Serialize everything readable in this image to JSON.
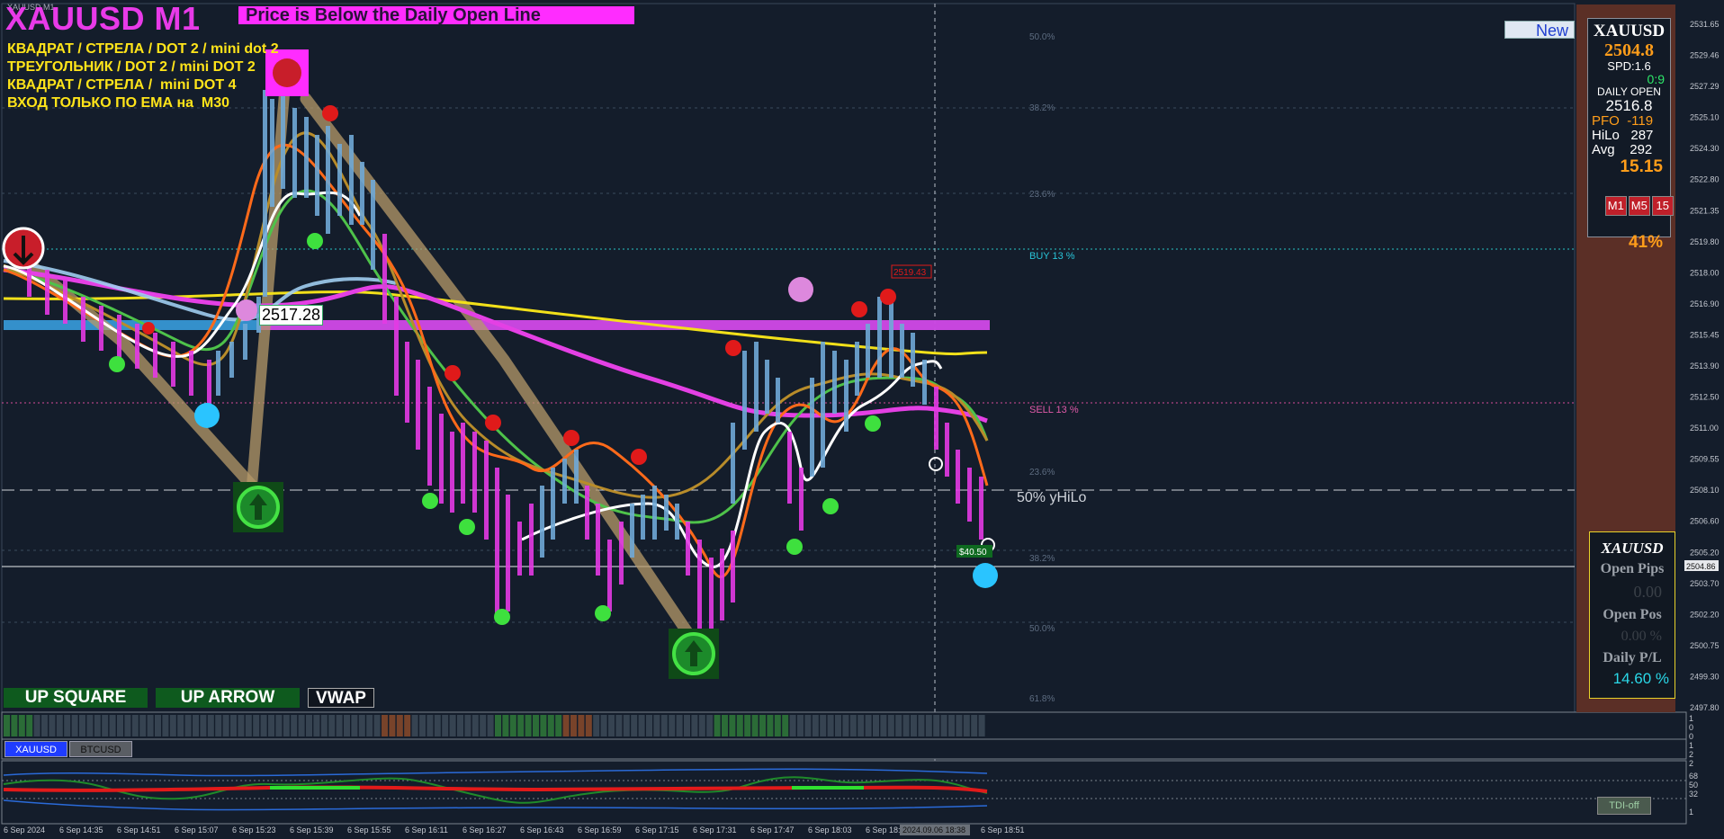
{
  "header": {
    "symbol_tiny": "XAUUSD,M1",
    "title": "XAUUSD M1",
    "banner": "Price is Below the Daily Open Line"
  },
  "notes": [
    "КВАДРАТ / СТРЕЛА / DOT 2 / mini dot 2",
    "ТРЕУГОЛЬНИК / DOT 2 / mini DOT 2",
    "КВАДРАТ / СТРЕЛА /  mini DOT 4",
    "ВХОД ТОЛЬКО ПО ЕМА на  M30"
  ],
  "new_button": "New",
  "info_panel": {
    "symbol": "XAUUSD",
    "price": "2504.8",
    "spread": "SPD:1.6",
    "seconds": "0:9",
    "daily_open_label": "DAILY OPEN",
    "daily_open": "2516.8",
    "pfo_label": "PFO",
    "pfo_value": "-119",
    "hilo_label": "HiLo",
    "hilo_value": "287",
    "avg_label": "Avg",
    "avg_value": "292",
    "range": "15.15",
    "timeframes": [
      "M1",
      "M5",
      "15"
    ],
    "percent": "41%"
  },
  "pl_panel": {
    "symbol": "XAUUSD",
    "open_pips_label": "Open Pips",
    "open_pips_value": "0.00",
    "open_pos_label": "Open Pos",
    "open_pos_value": "0.00 %",
    "daily_pl_label": "Daily P/L",
    "daily_pl_value": "14.60 %"
  },
  "bottom_buttons": {
    "up_square": "UP SQUARE",
    "up_arrow": "UP ARROW",
    "vwap": "VWAP"
  },
  "chart_labels": {
    "price_tag": "2517.28",
    "yhilo": "50% yHiLo",
    "buy_level": "BUY 13 %",
    "sell_level": "SELL 13 %",
    "level_box": "2519.43",
    "pnl_tag": "$40.50",
    "current_price": "2504.86",
    "fib_levels": [
      "50.0%",
      "38.2%",
      "23.6%",
      "23.6%",
      "38.2%",
      "50.0%",
      "61.8%"
    ]
  },
  "price_axis": [
    "2531.65",
    "2529.46",
    "2527.29",
    "2525.10",
    "2524.30",
    "2522.80",
    "2521.35",
    "2519.80",
    "2518.00",
    "2516.90",
    "2515.45",
    "2513.90",
    "2512.50",
    "2511.00",
    "2509.55",
    "2508.10",
    "2506.60",
    "2505.20",
    "2503.70",
    "2502.20",
    "2500.75",
    "2499.30",
    "2497.80"
  ],
  "time_axis": [
    "6 Sep 2024",
    "6 Sep 14:35",
    "6 Sep 14:51",
    "6 Sep 15:07",
    "6 Sep 15:23",
    "6 Sep 15:39",
    "6 Sep 15:55",
    "6 Sep 16:11",
    "6 Sep 16:27",
    "6 Sep 16:43",
    "6 Sep 16:59",
    "6 Sep 17:15",
    "6 Sep 17:31",
    "6 Sep 17:47",
    "6 Sep 18:03",
    "6 Sep 18:19",
    "6 Sep 18:51"
  ],
  "crosshair_time": "2024.09.06 18:38",
  "subwindow_tabs": [
    "XAUUSD",
    "BTCUSD"
  ],
  "sub1_axis": [
    "1",
    "0",
    "0"
  ],
  "sub2_axis": [
    "1",
    "2"
  ],
  "sub3_axis": [
    "2",
    "68",
    "50",
    "32",
    "1"
  ],
  "tdi_button": "TDI-off",
  "colors": {
    "background": "#141d2b",
    "magenta": "#ff2cff",
    "yellow": "#ffe41a",
    "panel_brown": "#5b2f26",
    "orange_price": "#ff9d1a"
  }
}
